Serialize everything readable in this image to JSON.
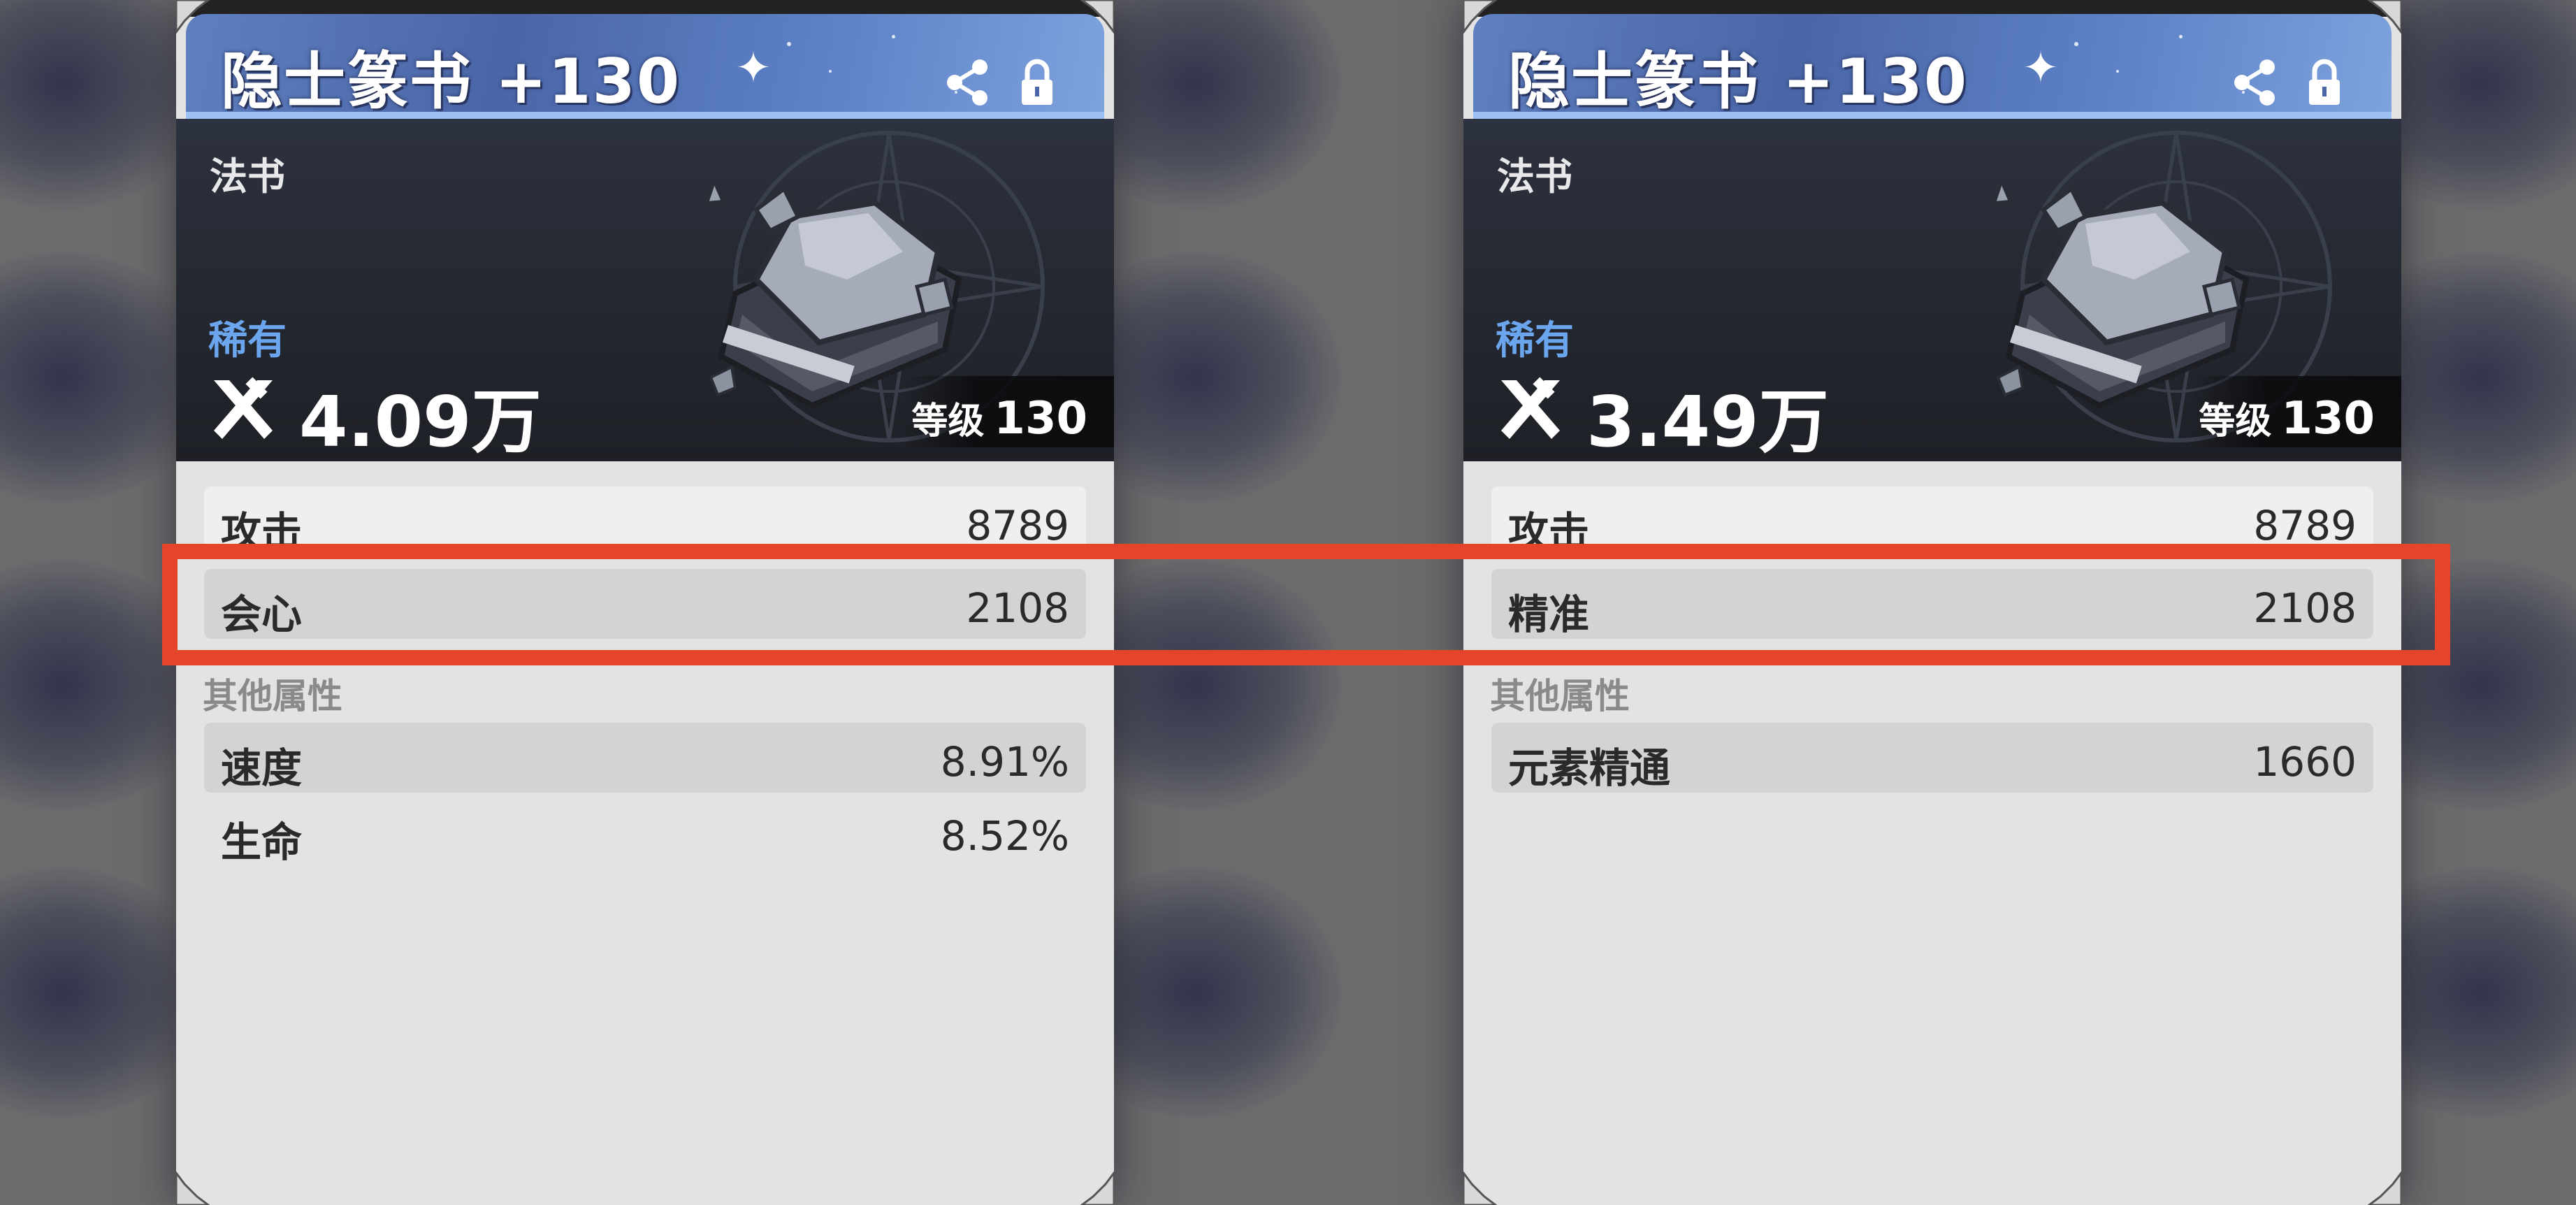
{
  "cards": [
    {
      "title": "隐士篆书 +130",
      "item_type": "法书",
      "rarity": "稀有",
      "power": "4.09万",
      "level_label": "等级",
      "level_value": "130",
      "main_stats": [
        {
          "name": "攻击",
          "value": "8789"
        },
        {
          "name": "会心",
          "value": "2108"
        }
      ],
      "other_label": "其他属性",
      "other_stats": [
        {
          "name": "速度",
          "value": "8.91%"
        },
        {
          "name": "生命",
          "value": "8.52%"
        }
      ]
    },
    {
      "title": "隐士篆书 +130",
      "item_type": "法书",
      "rarity": "稀有",
      "power": "3.49万",
      "level_label": "等级",
      "level_value": "130",
      "main_stats": [
        {
          "name": "攻击",
          "value": "8789"
        },
        {
          "name": "精准",
          "value": "2108"
        }
      ],
      "other_label": "其他属性",
      "other_stats": [
        {
          "name": "元素精通",
          "value": "1660"
        }
      ]
    }
  ],
  "icons": {
    "share": "share-icon",
    "lock": "lock-icon",
    "power": "crossed-swords-icon",
    "item": "stone-book-icon"
  },
  "colors": {
    "title_bar": "#5e7fc0",
    "rarity": "#6aa5ee",
    "highlight": "#e5452b",
    "card_bg": "#e3e3e3"
  }
}
